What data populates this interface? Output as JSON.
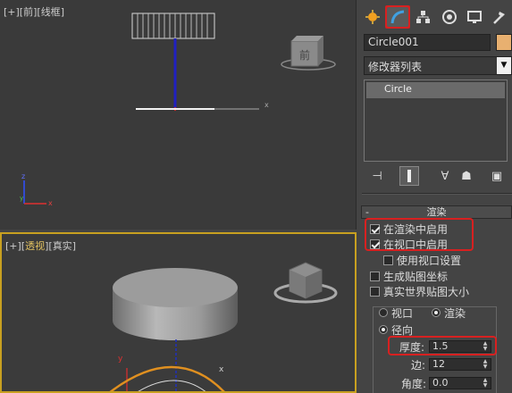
{
  "viewports": {
    "front": {
      "label_prefix": "[+][",
      "view_name": "前",
      "label_sep": "][",
      "shading": "线框",
      "label_suffix": "]",
      "cube_label": "前"
    },
    "perspective": {
      "label_prefix": "[+][",
      "view_name": "透视",
      "label_sep": "][",
      "shading": "真实",
      "label_suffix": "]"
    }
  },
  "panel": {
    "object_name": "Circle001",
    "modifier_list": "修改器列表",
    "stack_items": [
      "Circle"
    ],
    "rollout_title": "渲染",
    "checkboxes": {
      "enable_in_renderer": "在渲染中启用",
      "enable_in_viewport": "在视口中启用",
      "use_viewport_settings": "使用视口设置",
      "generate_mapping": "生成贴图坐标",
      "real_world_map_size": "真实世界贴图大小"
    },
    "radios": {
      "viewport": "视口",
      "render": "渲染",
      "radial": "径向"
    },
    "params": {
      "thickness_label": "厚度:",
      "thickness_value": "1.5",
      "sides_label": "边:",
      "sides_value": "12",
      "angle_label": "角度:",
      "angle_value": "0.0"
    }
  },
  "colors": {
    "object_color": "#e8b070",
    "highlight": "#d82020",
    "active_viewport": "#c8a020"
  }
}
